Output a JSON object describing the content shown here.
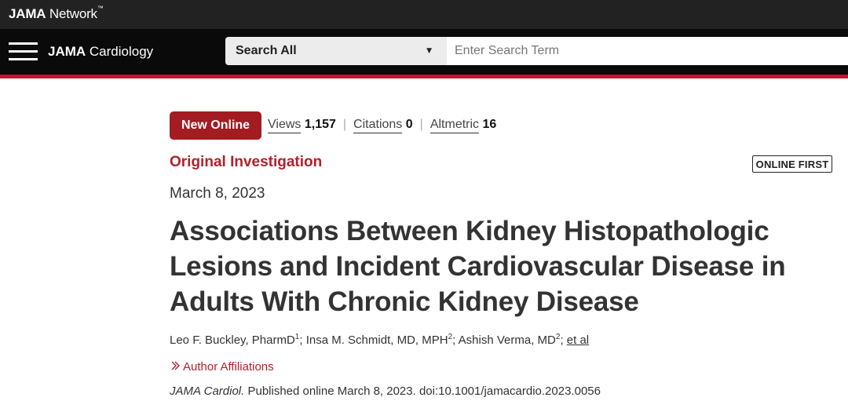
{
  "network": {
    "logo_bold": "JAMA",
    "logo_light": "Network",
    "trademark": "™"
  },
  "journal": {
    "logo_bold": "JAMA",
    "logo_light": "Cardiology"
  },
  "search": {
    "scope_label": "Search All",
    "caret": "▼",
    "placeholder": "Enter Search Term"
  },
  "colors": {
    "accent": "#c8102e",
    "badge": "#a31c22",
    "section": "#b3202a"
  },
  "article": {
    "badge": "New Online",
    "metrics": [
      {
        "label": "Views",
        "value": "1,157"
      },
      {
        "label": "Citations",
        "value": "0"
      },
      {
        "label": "Altmetric",
        "value": "16"
      }
    ],
    "metric_separator": "|",
    "section": "Original Investigation",
    "online_first": "ONLINE FIRST",
    "date": "March 8, 2023",
    "title": "Associations Between Kidney Histopathologic Lesions and Incident Cardiovascular Disease in Adults With Chronic Kidney Disease",
    "authors": [
      {
        "name": "Leo F. Buckley, PharmD",
        "sup": "1"
      },
      {
        "name": "Insa M. Schmidt, MD, MPH",
        "sup": "2"
      },
      {
        "name": "Ashish Verma, MD",
        "sup": "2"
      }
    ],
    "et_al": "et al",
    "affiliations_label": "Author Affiliations",
    "affiliations_icon": "chevron-right-icon",
    "citation_journal": "JAMA Cardiol.",
    "citation_text": " Published online March 8, 2023. doi:10.1001/jamacardio.2023.0056"
  }
}
